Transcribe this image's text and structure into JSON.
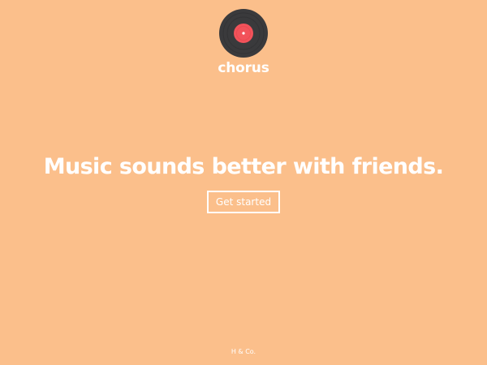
{
  "brand": {
    "name": "chorus",
    "icon": "vinyl-record-icon"
  },
  "hero": {
    "title": "Music sounds better with friends.",
    "cta_label": "Get started"
  },
  "footer": {
    "credit": "H & Co."
  },
  "colors": {
    "background": "#FBBF8B",
    "text": "#FFFFFF",
    "record": "#3A3A3C",
    "label": "#F2525A"
  }
}
